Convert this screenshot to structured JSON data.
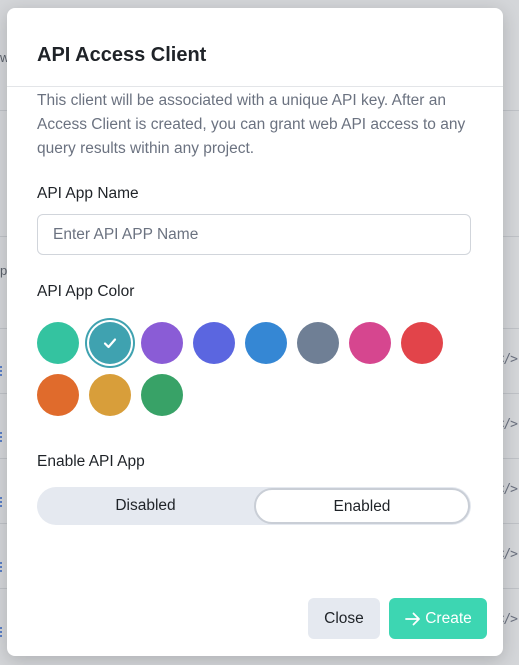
{
  "modal": {
    "title": "API Access Client",
    "description": "This client will be associated with a unique API key. After an Access Client is created, you can grant web API access to any query results within any project.",
    "app_name": {
      "label": "API App Name",
      "placeholder": "Enter API APP Name",
      "value": ""
    },
    "app_color": {
      "label": "API App Color",
      "selected_index": 1,
      "colors": [
        "#34c3a0",
        "#3fa2b0",
        "#8a5cd6",
        "#5b66e0",
        "#3587d4",
        "#6f7f95",
        "#d6468f",
        "#e2444a",
        "#e06b2c",
        "#d89e3a",
        "#38a267"
      ]
    },
    "enable": {
      "label": "Enable API App",
      "options": [
        "Disabled",
        "Enabled"
      ],
      "selected": "Enabled"
    },
    "buttons": {
      "close": "Close",
      "create": "Create"
    }
  },
  "background": {
    "fragments": [
      "w",
      "p"
    ],
    "code_glyph": "</>"
  }
}
